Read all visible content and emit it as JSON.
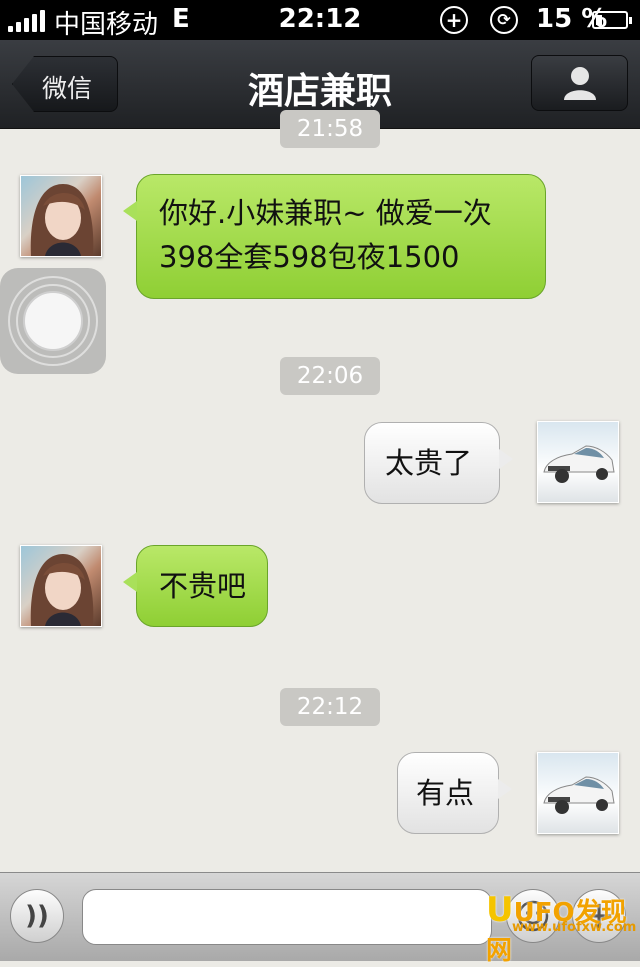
{
  "status_bar": {
    "carrier": "中国移动",
    "network": "E",
    "time": "22:12",
    "battery_percent": "15 %"
  },
  "nav": {
    "back_label": "微信",
    "title": "酒店兼职"
  },
  "messages": [
    {
      "type": "timestamp",
      "text": "21:58"
    },
    {
      "type": "incoming",
      "line1": "你好.小妹兼职~ 做爱一次",
      "line2": "398全套598包夜1500"
    },
    {
      "type": "timestamp",
      "text": "22:06"
    },
    {
      "type": "outgoing",
      "text": "太贵了"
    },
    {
      "type": "incoming",
      "text": "不贵吧"
    },
    {
      "type": "timestamp",
      "text": "22:12"
    },
    {
      "type": "outgoing",
      "text": "有点"
    }
  ],
  "watermark": {
    "logo_letter": "U",
    "text": "UFO发现网",
    "url": "www.ufofxw.com"
  },
  "colors": {
    "incoming_bubble": "#a9e05a",
    "outgoing_bubble": "#ececec",
    "nav_bar": "#2c2f33"
  }
}
